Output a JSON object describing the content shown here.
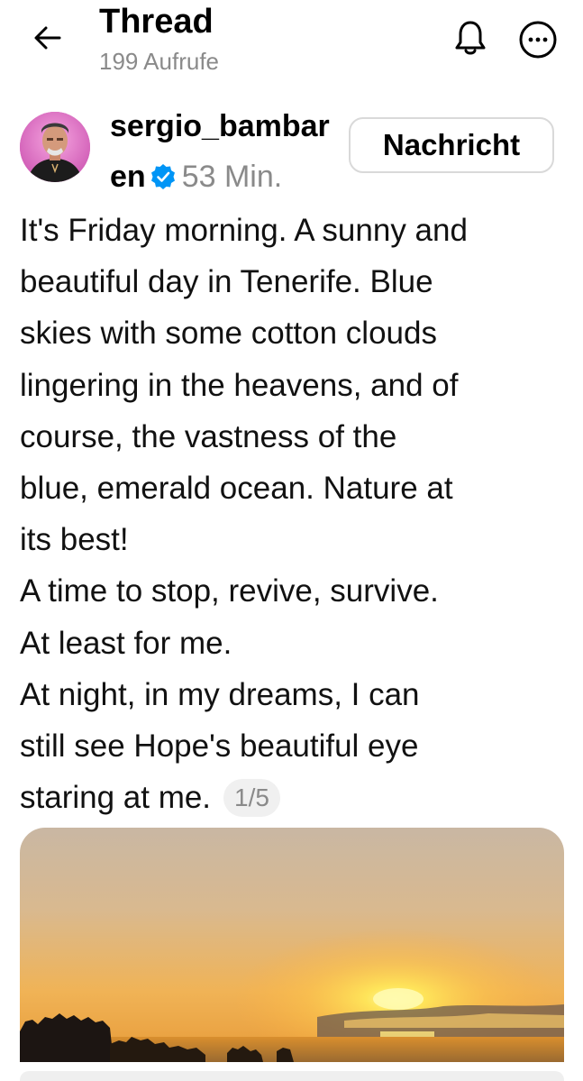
{
  "header": {
    "title": "Thread",
    "views": "199 Aufrufe",
    "icons": [
      "back-arrow-icon",
      "bell-icon",
      "more-icon"
    ]
  },
  "author": {
    "username": "sergio_bambaren",
    "verified": true,
    "time": "53 Min.",
    "message_button": "Nachricht"
  },
  "post": {
    "lines": [
      "It's Friday morning. A sunny and",
      "beautiful day in Tenerife. Blue",
      "skies with some cotton clouds",
      "lingering in the heavens, and of",
      "course, the vastness of the",
      "blue, emerald ocean. Nature at",
      "its best!",
      "A time to stop, revive, survive.",
      "At least for me.",
      "At night, in my dreams, I can",
      "still see Hope's beautiful eye",
      "staring at me."
    ],
    "page_indicator": "1/5"
  },
  "colors": {
    "accent_verified": "#0095f6",
    "muted_text": "#8a8a8a",
    "avatar_ring": "#d96ac0"
  }
}
